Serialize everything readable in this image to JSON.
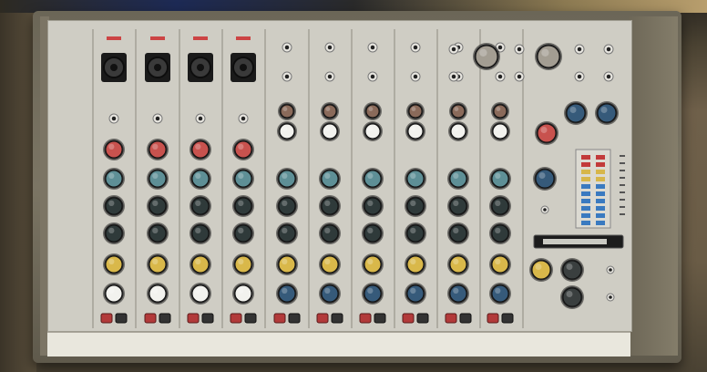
{
  "scene": {
    "device": "audio-mixer",
    "knob_colors": {
      "gain": "#c8524e",
      "eq": "#5e8f96",
      "aux": "#2f3a3a",
      "pan_yellow": "#d9b84a",
      "pan_white": "#f2f2ee",
      "pan_blue": "#365a7a",
      "mute_red": "#b23a3a"
    },
    "channels": {
      "mono_count": 4,
      "stereo_count": 6
    },
    "master": {
      "meter_icon": "vu-meter-icon"
    }
  }
}
